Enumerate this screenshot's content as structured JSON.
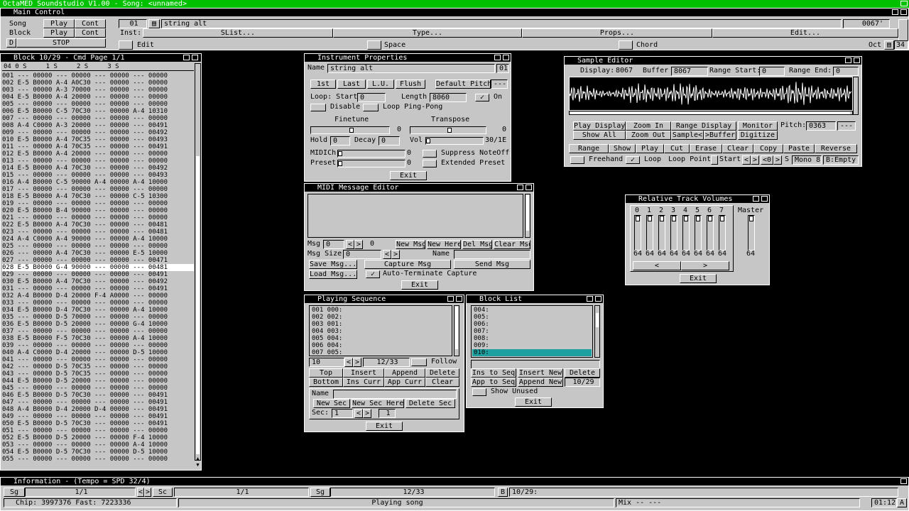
{
  "app_title": "OctaMED Soundstudio V1.00 - Song: <unnamed>",
  "main_control": {
    "title": "Main Control",
    "song_label": "Song",
    "block_label": "Block",
    "play1": "Play",
    "cont1": "Cont",
    "play2": "Play",
    "cont2": "Cont",
    "d_label": "D",
    "stop": "STOP",
    "instr_num": "01",
    "instr_name": "string alt",
    "inst_label": "Inst:",
    "slist": "SList...",
    "type": "Type...",
    "props": "Props...",
    "edit_btn": "Edit...",
    "tempo_value": "0067'",
    "edit_label": "Edit",
    "space_label": "Space",
    "chord_label": "Chord",
    "oct_label": "Oct",
    "oct_value": "34"
  },
  "block": {
    "title": "Block 10/29 - Cmd Page 1/1",
    "header_line": "04 0 S     1 S     2 S     3 S",
    "rows": [
      "001 --- 00000 --- 00000 --- 00000 --- 00000",
      "002 E-5 B0000 A-4 A0C30 --- 00000 --- 00000",
      "003 --- 00000 A-3 70000 --- 00000 --- 00000",
      "004 E-5 B0000 A-4 20000 --- 00000 --- 00000",
      "005 --- 00000 --- 00000 --- 00000 --- 00000",
      "006 E-5 B0000 C-5 70C30 --- 00000 A-4 10310",
      "007 --- 00000 --- 00000 --- 00000 --- 00000",
      "008 A-4 C0000 A-3 20000 --- 00000 --- 00491",
      "009 --- 00000 --- 00000 --- 00000 --- 00492",
      "010 E-5 B0000 A-4 70C35 --- 00000 --- 00493",
      "011 --- 00000 A-4 70C35 --- 00000 --- 00491",
      "012 E-5 B0000 A-4 20000 --- 00000 --- 00000",
      "013 --- 00000 --- 00000 --- 00000 --- 00000",
      "014 E-5 B0000 A-4 70C30 --- 00000 --- 00492",
      "015 --- 00000 --- 00000 --- 00000 --- 00493",
      "016 A-4 B0000 C-5 90000 A-4 00000 A-4 10000",
      "017 --- 00000 --- 00000 --- 00000 --- 00000",
      "018 E-5 B0000 A-4 70C30 --- 00000 C-5 10300",
      "019 --- 00000 --- 00000 --- 00000 --- 00000",
      "020 E-5 B0000 B-4 90000 --- 00000 --- 00000",
      "021 --- 00000 --- 00000 --- 00000 --- 00000",
      "022 E-5 B0000 A-4 70C30 --- 00000 --- 00481",
      "023 --- 00000 --- 00000 --- 00000 --- 00481",
      "024 A-4 C0000 A-4 90000 --- 00000 A-4 10000",
      "025 --- 00000 --- 00000 --- 00000 --- 00000",
      "026 --- 00000 A-4 70C30 --- 00000 E-5 10000",
      "027 --- 00000 --- 00000 --- 00000 --- 00471",
      "028 E-5 B0000 G-4 90000 --- 00000 --- 00481",
      "029 --- 00000 --- 00000 --- 00000 --- 00491",
      "030 E-5 B0000 A-4 70C30 --- 00000 --- 00492",
      "031 --- 00000 --- 00000 --- 00000 --- 00491",
      "032 A-4 B0000 D-4 20000 F-4 A0000 --- 00000",
      "033 --- 00000 --- 00000 --- 00000 --- 00000",
      "034 E-5 B0000 D-4 70C30 --- 00000 A-4 10000",
      "035 --- 00000 D-5 70000 --- 00000 --- 00000",
      "036 E-5 B0000 D-5 20000 --- 00000 G-4 10000",
      "037 --- 00000 --- 00000 --- 00000 --- 00000",
      "038 E-5 B0000 F-5 70C30 --- 00000 A-4 10000",
      "039 --- 00000 --- 00000 --- 00000 --- 00000",
      "040 A-4 C0000 D-4 20000 --- 00000 D-5 10000",
      "041 --- 00000 --- 00000 --- 00000 --- 00000",
      "042 --- 00000 D-5 70C35 --- 00000 --- 00000",
      "043 --- 00000 D-5 70C35 --- 00000 --- 00000",
      "044 E-5 B0000 D-5 20000 --- 00000 --- 00000",
      "045 --- 00000 --- 00000 --- 00000 --- 00000",
      "046 E-5 B0000 D-5 70C30 --- 00000 --- 00491",
      "047 --- 00000 --- 00000 --- 00000 --- 00491",
      "048 A-4 B0000 D-4 20000 D-4 00000 --- 00491",
      "049 --- 00000 --- 00000 --- 00000 --- 00491",
      "050 E-5 B0000 D-5 70C30 --- 00000 --- 00491",
      "051 --- 00000 --- 00000 --- 00000 --- 00000",
      "052 E-5 B0000 D-5 20000 --- 00000 F-4 10000",
      "053 --- 00000 --- 00000 --- 00000 A-4 10000",
      "054 E-5 B0000 D-5 70C30 --- 00000 D-5 10000",
      "055 --- 00000 --- 00000 --- 00000 --- 00000"
    ],
    "highlight_index": 27
  },
  "instrument": {
    "title": "Instrument Properties",
    "name_label": "Name",
    "name_value": "string alt",
    "num": "01",
    "b1": "1st",
    "b2": "Last",
    "b3": "L.U.",
    "b4": "Flush",
    "default_pitch": "Default Pitch",
    "dp_value": "---",
    "loop_start_label": "Loop: Start",
    "loop_start": "0",
    "length_label": "Length",
    "length": "8060",
    "on": "On",
    "disable": "Disable",
    "pingpong": "Loop Ping-Pong",
    "finetune": "Finetune",
    "transpose": "Transpose",
    "ft_value": "0",
    "tr_value": "0",
    "hold_label": "Hold",
    "hold": "0",
    "decay_label": "Decay",
    "decay": "0",
    "vol_label": "Vol",
    "vol_value": "30/1E",
    "midich_label": "MIDICh",
    "midich": "0",
    "suppress": "Suppress NoteOff",
    "preset_label": "Preset",
    "preset": "0",
    "extended": "Extended Preset",
    "exit": "Exit"
  },
  "midi": {
    "title": "MIDI Message Editor",
    "msg_label": "Msg",
    "msg": "0",
    "msg_of": "0",
    "new_msg": "New Msg",
    "new_here": "New Here",
    "del_msg": "Del Msg",
    "clear_msg": "Clear Msg",
    "size_label": "Msg Size",
    "size": "0",
    "name_label": "Name",
    "save": "Save Msg...",
    "capture": "Capture Msg",
    "send": "Send Msg",
    "load": "Load Msg...",
    "auto": "Auto-Terminate Capture",
    "exit": "Exit"
  },
  "sample": {
    "title": "Sample Editor",
    "display_label": "Display:",
    "display": "8067",
    "buffer_label": "Buffer",
    "buffer": "8067",
    "rs_label": "Range Start:",
    "rs": "0",
    "re_label": "Range End:",
    "re": "0",
    "play_display": "Play Display",
    "zoom_in": "Zoom In",
    "range_display": "Range Display",
    "monitor": "Monitor",
    "pitch_label": "Pitch:",
    "pitch": "0363",
    "pitch2": "---",
    "show_all": "Show All",
    "zoom_out": "Zoom Out",
    "sample_lt": "Sample<",
    "buffer_gt": ">Buffer",
    "digitize": "Digitize",
    "range": "Range",
    "show": "Show",
    "play": "Play",
    "cut": "Cut",
    "erase": "Erase",
    "clear": "Clear",
    "copy": "Copy",
    "paste": "Paste",
    "reverse": "Reverse",
    "freehand": "Freehand",
    "loop": "Loop",
    "loop_point": "Loop Point",
    "start": "Start",
    "nav": "<0",
    "s": "S",
    "mono": "Mono 8",
    "b_empty": "B:Empty"
  },
  "rtv": {
    "title": "Relative Track Volumes",
    "tracks": [
      "0",
      "1",
      "2",
      "3",
      "4",
      "5",
      "6",
      "7"
    ],
    "values": [
      "64",
      "64",
      "64",
      "64",
      "64",
      "64",
      "64",
      "64"
    ],
    "master_label": "Master",
    "master_value": "64",
    "left": "<",
    "right": ">",
    "exit": "Exit"
  },
  "seq": {
    "title": "Playing Sequence",
    "lines": "001 000:\n002 002:\n003 001:\n004 003:\n005 004:\n006 004:\n007 005:",
    "pos": "10",
    "count": "12/33",
    "follow": "Follow",
    "top": "Top",
    "insert": "Insert",
    "append": "Append",
    "delete": "Delete",
    "bottom": "Bottom",
    "ins_curr": "Ins Curr",
    "app_curr": "App Curr",
    "clear": "Clear",
    "name_label": "Name",
    "new_sec": "New Sec",
    "new_sec_here": "New Sec Here",
    "delete_sec": "Delete Sec",
    "sec_label": "Sec:",
    "sec": "1",
    "sec_of": "1",
    "exit": "Exit"
  },
  "blocklist": {
    "title": "Block List",
    "lines": "004:\n005:\n006:\n007:\n008:\n009:",
    "selected": "010:",
    "ins_to_seq": "Ins to Seq",
    "insert_new": "Insert New",
    "delete": "Delete",
    "app_to_seq": "App to Seq",
    "append_new": "Append New",
    "count": "10/29",
    "show_unused": "Show Unused",
    "exit": "Exit"
  },
  "info": {
    "title": "Information - (Tempo = SPD 32/4)",
    "sg1": "Sg",
    "v1": "1/1",
    "sc": "Sc",
    "v2": "1/1",
    "sg2": "Sg",
    "v3": "12/33",
    "b": "B",
    "v4": "10/29:",
    "chip": "Chip: 3997376 Fast: 7223336",
    "status": "Playing song",
    "mix": "Mix -- ---",
    "time": "01:12",
    "a": "A"
  }
}
